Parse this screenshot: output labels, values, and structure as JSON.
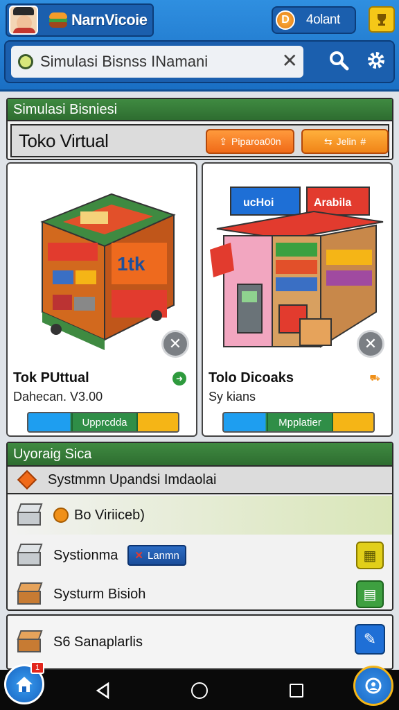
{
  "header": {
    "app_name": "NarnVicoie",
    "coin_symbol": "D",
    "coin_label": "4olant",
    "trophy_icon": "trophy-icon"
  },
  "search": {
    "value": "Simulasi Bisnss INamani",
    "placeholder": "Simulasi Bisnss INamani"
  },
  "sim_panel": {
    "title": "Simulasi Bisniesi",
    "store_title": "Toko Virtual",
    "upgrade_button": "Piparoa00n",
    "shop_button": "Jelin",
    "shop_button_suffix": "#"
  },
  "cards": [
    {
      "title": "Tok PUttual",
      "subtitle": "Dahecan. V3.00",
      "button": "Upprcdda",
      "badge_color": "#2e9a3d"
    },
    {
      "title": "Tolo Dicoaks",
      "subtitle": "Sy kians",
      "button": "Mpplatier",
      "badge_color": "#f09018"
    }
  ],
  "upgrade_panel": {
    "title": "Uyoraig Sica",
    "subtitle": "Systmmn Upandsi Imdaolai",
    "rows": [
      {
        "label": "Bo Viriiceb)"
      },
      {
        "label": "Systionma",
        "tag": "Lanmn"
      },
      {
        "label": "Systurm Bisioh"
      }
    ]
  },
  "extra_item": {
    "label": "S6 Sanaplarlis"
  },
  "nav": {
    "home_badge": "1"
  },
  "colors": {
    "primary": "#1f7ad6",
    "section_green": "#3f8a41",
    "accent_orange": "#f06a18",
    "accent_yellow": "#f5b516"
  }
}
